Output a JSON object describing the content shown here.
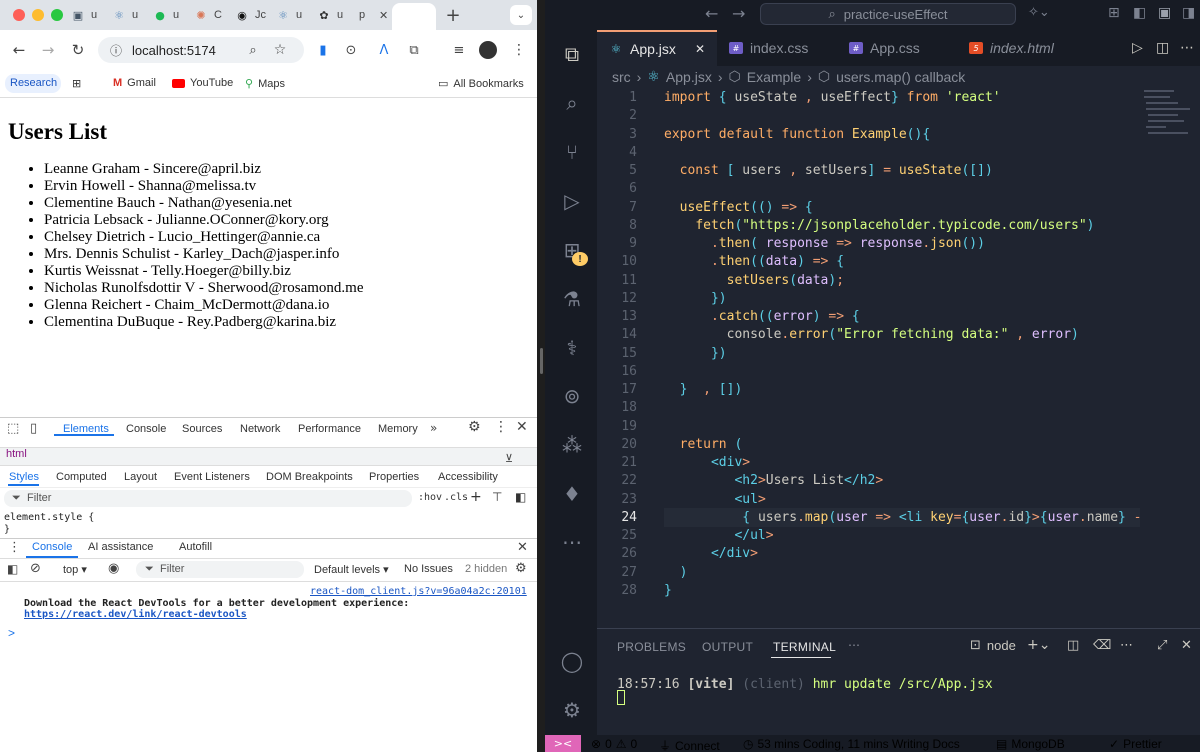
{
  "browser": {
    "tabs": [
      {
        "label": "u",
        "icon": "image-icon"
      },
      {
        "label": "u",
        "icon": "react-icon"
      },
      {
        "label": "u",
        "icon": "spotify-icon"
      },
      {
        "label": "C",
        "icon": "claude-icon"
      },
      {
        "label": "Jc",
        "icon": "github-icon"
      },
      {
        "label": "u",
        "icon": "react-icon"
      },
      {
        "label": "u",
        "icon": "openai-icon"
      },
      {
        "label": "p",
        "icon": "page-icon",
        "active": true
      }
    ],
    "new_tab": "+",
    "url": "localhost:5174",
    "bookmarks": {
      "research": "Research",
      "gmail": "Gmail",
      "youtube": "YouTube",
      "maps": "Maps",
      "all": "All Bookmarks"
    },
    "page": {
      "title": "Users List",
      "users": [
        "Leanne Graham - Sincere@april.biz",
        "Ervin Howell - Shanna@melissa.tv",
        "Clementine Bauch - Nathan@yesenia.net",
        "Patricia Lebsack - Julianne.OConner@kory.org",
        "Chelsey Dietrich - Lucio_Hettinger@annie.ca",
        "Mrs. Dennis Schulist - Karley_Dach@jasper.info",
        "Kurtis Weissnat - Telly.Hoeger@billy.biz",
        "Nicholas Runolfsdottir V - Sherwood@rosamond.me",
        "Glenna Reichert - Chaim_McDermott@dana.io",
        "Clementina DuBuque - Rey.Padberg@karina.biz"
      ]
    },
    "devtools": {
      "tabs": [
        "Elements",
        "Console",
        "Sources",
        "Network",
        "Performance",
        "Memory"
      ],
      "crumb": "html",
      "style_tabs": [
        "Styles",
        "Computed",
        "Layout",
        "Event Listeners",
        "DOM Breakpoints",
        "Properties",
        "Accessibility"
      ],
      "filter_placeholder": "Filter",
      "hov": ":hov",
      "cls": ".cls",
      "element_style_open": "element.style {",
      "element_style_close": "}",
      "console_tabs": [
        "Console",
        "AI assistance",
        "Autofill"
      ],
      "context": "top",
      "console_filter": "Filter",
      "levels": "Default levels",
      "issues": "No Issues",
      "hidden": "2 hidden",
      "log_source": "react-dom_client.js?v=96a04a2c:20101",
      "log_message": "Download the React DevTools for a better development experience:",
      "log_link": "https://react.dev/link/react-devtools",
      "prompt": ">"
    }
  },
  "vscode": {
    "command_center": "practice-useEffect",
    "tabs": [
      {
        "label": "App.jsx",
        "icon": "react-icon",
        "active": true
      },
      {
        "label": "index.css",
        "icon": "css-icon"
      },
      {
        "label": "App.css",
        "icon": "css-icon"
      },
      {
        "label": "index.html",
        "icon": "html-icon"
      }
    ],
    "breadcrumb": [
      "src",
      "App.jsx",
      "Example",
      "users.map() callback"
    ],
    "code_lines": [
      "import { useState , useEffect} from 'react'",
      "",
      "export default function Example(){",
      "",
      "  const [ users , setUsers] = useState([])",
      "",
      "  useEffect(() => {",
      "    fetch(\"https://jsonplaceholder.typicode.com/users\")",
      "      .then( response => response.json())",
      "      .then((data) => {",
      "        setUsers(data);",
      "      })",
      "      .catch((error) => {",
      "        console.error(\"Error fetching data:\" , error)",
      "      })",
      "",
      "  }  , [])",
      "",
      "",
      "  return (",
      "      <div>",
      "         <h2>Users List</h2>",
      "         <ul>",
      "          { users.map(user => <li key={user.id}>{user.name} - {us",
      "         </ul>",
      "      </div>",
      "  )",
      "}"
    ],
    "current_line": 24,
    "panel_tabs": [
      "PROBLEMS",
      "OUTPUT",
      "TERMINAL"
    ],
    "terminal_shell": "node",
    "terminal_line": {
      "time": "18:57:16",
      "tag": "[vite]",
      "client": "(client)",
      "message": "hmr update /src/App.jsx"
    },
    "status": {
      "problems": "0",
      "warnings": "0",
      "connect": "Connect",
      "coding": "53 mins Coding, 11 mins Writing Docs",
      "mongo": "MongoDB",
      "prettier": "Prettier"
    },
    "colors": {
      "accent": "#e066b8",
      "tab_accent": "#f29e74"
    }
  }
}
